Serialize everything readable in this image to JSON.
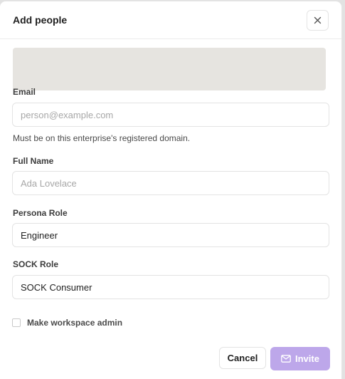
{
  "dialog": {
    "title": "Add people",
    "close_icon": "close-icon"
  },
  "form": {
    "email": {
      "label": "Email",
      "placeholder": "person@example.com",
      "hint": "Must be on this enterprise's registered domain."
    },
    "full_name": {
      "label": "Full Name",
      "placeholder": "Ada Lovelace"
    },
    "persona_role": {
      "label": "Persona Role",
      "value": "Engineer"
    },
    "sock_role": {
      "label": "SOCK Role",
      "value": "SOCK Consumer"
    },
    "workspace_admin": {
      "label": "Make workspace admin",
      "checked": false
    }
  },
  "actions": {
    "cancel_label": "Cancel",
    "invite_label": "Invite",
    "invite_icon": "envelope-icon"
  },
  "colors": {
    "accent": "#bda7ea"
  }
}
